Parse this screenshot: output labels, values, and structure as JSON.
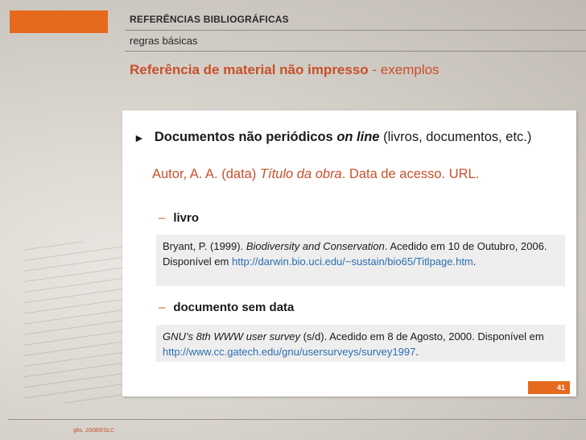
{
  "header": {
    "section": "REFERÊNCIAS BIBLIOGRÁFICAS",
    "subsection": "regras básicas"
  },
  "title": {
    "bold": "Referência de material não impresso",
    "rest": " - exemplos"
  },
  "bullet": {
    "bold": "Documentos não periódicos ",
    "bold_italic": "on line",
    "rest": " (livros, documentos, etc.)"
  },
  "format": {
    "part1": "Autor, A. A. (data) ",
    "italic": "Título da obra",
    "part2": ". Data de acesso. URL."
  },
  "examples": [
    {
      "label": "livro",
      "t1": "Bryant, P. (1999). ",
      "title": "Biodiversity and Conservation",
      "t2": ".  Acedido em 10 de Outubro, 2006. Disponível em ",
      "url": "http://darwin.bio.uci.edu/~sustain/bio65/Titlpage.htm",
      "t3": "."
    },
    {
      "label": "documento sem data",
      "title": "GNU’s 8th WWW user survey",
      "t1": " (s/d). Acedido em 8 de Agosto, 2000. Disponível em ",
      "url": "http://www.cc.gatech.edu/gnu/usersurveys/survey1997",
      "t2": "."
    }
  ],
  "page_number": "41",
  "footer": "gbs. 2008/ESLC",
  "colors": {
    "accent": "#e56a1e",
    "title": "#c8502b",
    "link": "#2b6fb0"
  }
}
